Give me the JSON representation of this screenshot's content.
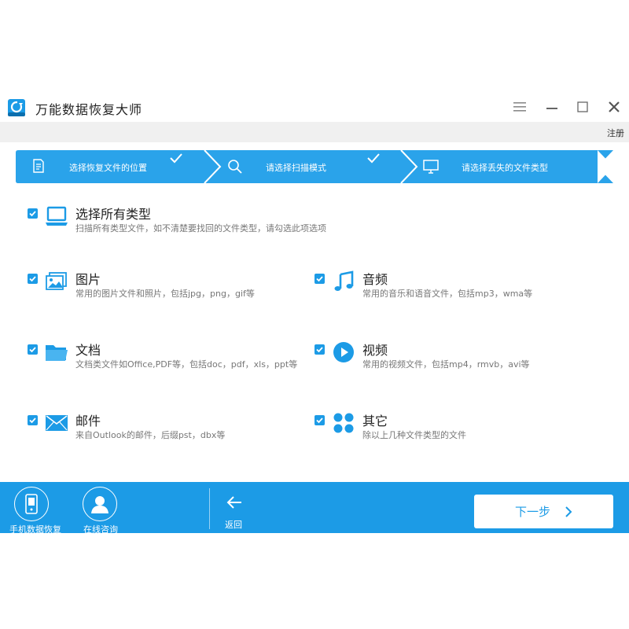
{
  "app": {
    "title": "万能数据恢复大师",
    "register_label": "注册"
  },
  "steps": [
    {
      "label": "选择恢复文件的位置",
      "icon": "document-edit-icon",
      "completed": true
    },
    {
      "label": "请选择扫描模式",
      "icon": "search-icon",
      "completed": true
    },
    {
      "label": "请选择丢失的文件类型",
      "icon": "monitor-icon",
      "completed": false
    }
  ],
  "options": {
    "all": {
      "title": "选择所有类型",
      "desc": "扫描所有类型文件，如不清楚要找回的文件类型，请勾选此项选项",
      "icon": "laptop-icon",
      "checked": true
    },
    "pictures": {
      "title": "图片",
      "desc": "常用的图片文件和照片，包括jpg，png，gif等",
      "icon": "picture-icon",
      "checked": true
    },
    "audio": {
      "title": "音频",
      "desc": "常用的音乐和语音文件，包括mp3，wma等",
      "icon": "music-note-icon",
      "checked": true
    },
    "documents": {
      "title": "文档",
      "desc": "文档类文件如Office,PDF等，包括doc，pdf，xls，ppt等",
      "icon": "folder-icon",
      "checked": true
    },
    "video": {
      "title": "视频",
      "desc": "常用的视频文件，包括mp4，rmvb，avi等",
      "icon": "play-icon",
      "checked": true
    },
    "email": {
      "title": "邮件",
      "desc": "来自Outlook的邮件，后缀pst，dbx等",
      "icon": "envelope-icon",
      "checked": true
    },
    "other": {
      "title": "其它",
      "desc": "除以上几种文件类型的文件",
      "icon": "grid-dots-icon",
      "checked": true
    }
  },
  "footer": {
    "phone_recovery_label": "手机数据恢复",
    "online_consult_label": "在线咨询",
    "back_label": "返回",
    "next_label": "下一步"
  },
  "colors": {
    "accent": "#1c9be6",
    "step_bar": "#2aa3ea"
  }
}
